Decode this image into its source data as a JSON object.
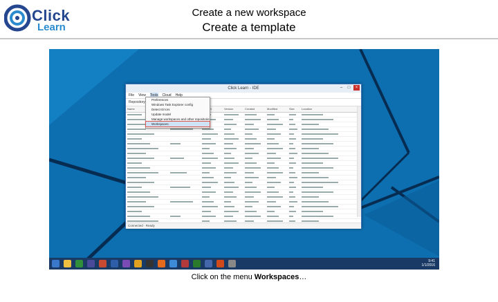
{
  "header": {
    "logo_top": "Click",
    "logo_bottom": "Learn",
    "title": "Create a new workspace",
    "subtitle": "Create a template"
  },
  "app_window": {
    "title": "Click Learn - IDE",
    "menu": [
      "File",
      "View",
      "Tools",
      "Cloud",
      "Help"
    ],
    "active_menu": "Tools",
    "toolbar_label": "Repository",
    "dropdown": [
      "Preferences",
      "Windows Task Explorer config",
      "Detect Errors",
      "Update model",
      "Manage workspaces and other repositories",
      "Workspaces"
    ],
    "highlighted_item": "Workspaces",
    "columns": [
      "Name",
      "",
      "Dataset",
      "Version",
      "Created",
      "Modified",
      "Size",
      "Location"
    ],
    "status": "Connected · Ready"
  },
  "taskbar": {
    "time": "9:41",
    "date": "1/1/2016"
  },
  "caption": {
    "prefix": "Click on the menu ",
    "bold": "Workspaces",
    "suffix": "…"
  },
  "colors": {
    "desktop": "#0d6fb0",
    "taskbar": "#1a3a66",
    "logo_dark": "#24478f",
    "logo_light": "#2a8ccf",
    "highlight_outline": "#d9534f"
  }
}
